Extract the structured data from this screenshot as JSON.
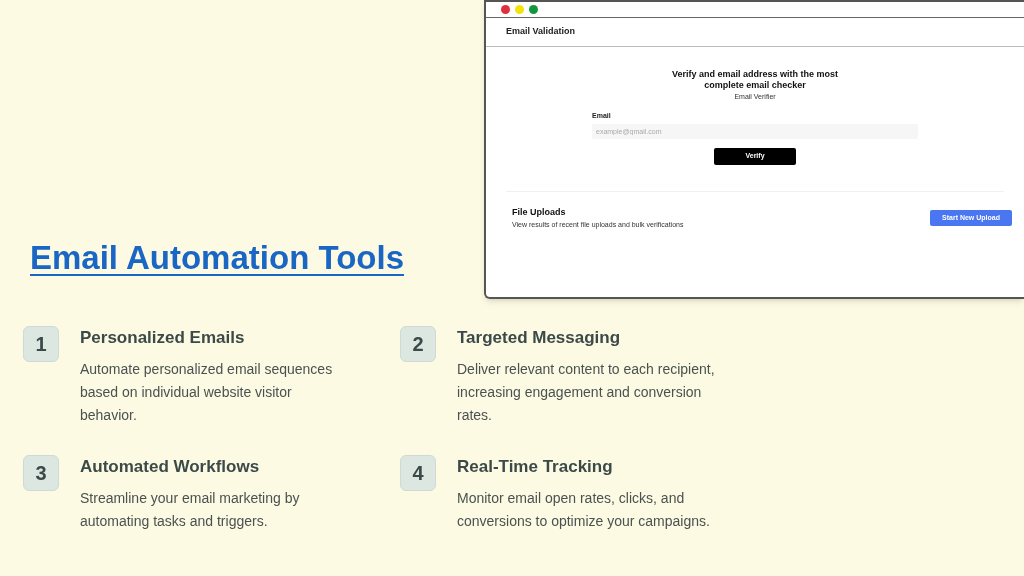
{
  "title": "Email Automation Tools",
  "app_window": {
    "header": "Email Validation",
    "heading": "Verify and email address with the most complete email checker",
    "subheading": "Email Verifier",
    "email_label": "Email",
    "email_placeholder": "example@gmail.com",
    "verify_button": "Verify",
    "uploads_title": "File Uploads",
    "uploads_description": "View results of recent file uploads and bulk verifications",
    "upload_button": "Start New Upload"
  },
  "features": [
    {
      "number": "1",
      "title": "Personalized Emails",
      "description": "Automate personalized email sequences based on individual website visitor behavior."
    },
    {
      "number": "2",
      "title": "Targeted Messaging",
      "description": "Deliver relevant content to each recipient, increasing engagement and conversion rates."
    },
    {
      "number": "3",
      "title": "Automated Workflows",
      "description": "Streamline your email marketing by automating tasks and triggers."
    },
    {
      "number": "4",
      "title": "Real-Time Tracking",
      "description": "Monitor email open rates, clicks, and conversions to optimize your campaigns."
    }
  ]
}
